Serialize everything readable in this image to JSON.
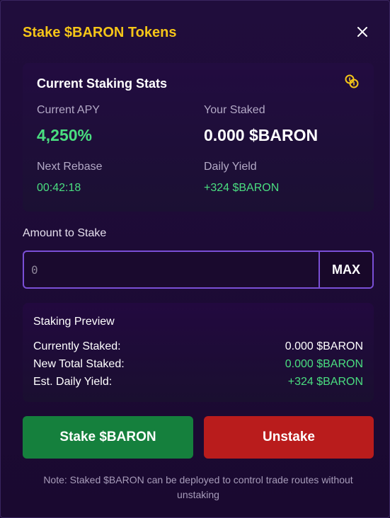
{
  "modal": {
    "title": "Stake $BARON Tokens",
    "close_icon": "close-icon"
  },
  "stats": {
    "title": "Current Staking Stats",
    "icon": "coins-icon",
    "apy_label": "Current APY",
    "apy_value": "4,250%",
    "staked_label": "Your Staked",
    "staked_value": "0.000 $BARON",
    "rebase_label": "Next Rebase",
    "rebase_value": "00:42:18",
    "yield_label": "Daily Yield",
    "yield_value": "+324 $BARON"
  },
  "amount": {
    "label": "Amount to Stake",
    "placeholder": "0",
    "value": "",
    "max_label": "MAX"
  },
  "preview": {
    "title": "Staking Preview",
    "rows": [
      {
        "label": "Currently Staked:",
        "value": "0.000 $BARON"
      },
      {
        "label": "New Total Staked:",
        "value": "0.000 $BARON"
      },
      {
        "label": "Est. Daily Yield:",
        "value": "+324 $BARON"
      }
    ]
  },
  "actions": {
    "stake_label": "Stake $BARON",
    "unstake_label": "Unstake"
  },
  "note": "Note: Staked $BARON can be deployed to control trade routes without unstaking",
  "colors": {
    "accent_gold": "#f5c518",
    "positive_green": "#4ade80",
    "stake_green": "#15803d",
    "unstake_red": "#b91c1c",
    "input_border": "#7a4fd6",
    "background": "#1d0c35"
  }
}
